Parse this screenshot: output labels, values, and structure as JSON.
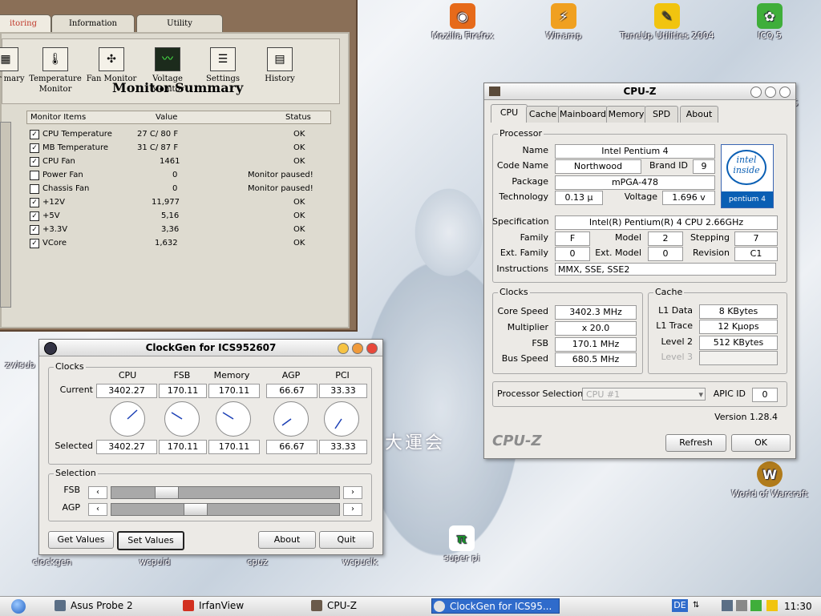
{
  "desktop": {
    "wallpaper_text": "大運会",
    "icons": [
      {
        "label": "Mozilla Firefox",
        "glyph": "◉",
        "color": "#e66a1a"
      },
      {
        "label": "Winamp",
        "glyph": "⚡",
        "color": "#f0a020"
      },
      {
        "label": "TuneUp Utilities 2004",
        "glyph": "✎",
        "color": "#f1c40f"
      },
      {
        "label": "ICQ 5",
        "glyph": "✿",
        "color": "#3fae3a"
      },
      {
        "label": "World of Warcraft",
        "glyph": "W",
        "color": "#b07b1b"
      },
      {
        "label": "super pi",
        "glyph": "π",
        "color": "#1b8a2a"
      },
      {
        "label": "clockgen",
        "glyph": "",
        "color": "#6c7a8a"
      },
      {
        "label": "wcpuid",
        "glyph": "",
        "color": "#6c7a8a"
      },
      {
        "label": "cpuz",
        "glyph": "",
        "color": "#6c7a8a"
      },
      {
        "label": "wcpuclk",
        "glyph": "",
        "color": "#6c7a8a"
      },
      {
        "label": "zwisub",
        "glyph": "",
        "color": "#6c7a8a"
      },
      {
        "label": "CS",
        "glyph": "",
        "color": "#6c7a8a"
      }
    ]
  },
  "probe": {
    "tabs": [
      "itoring",
      "Information",
      "Utility"
    ],
    "tools": [
      {
        "label": "itor mary",
        "glyph": "▦"
      },
      {
        "label": "Temperature Monitor",
        "glyph": "🌡"
      },
      {
        "label": "Fan Monitor",
        "glyph": "✣"
      },
      {
        "label": "Voltage Monitor",
        "glyph": "〰"
      },
      {
        "label": "Settings",
        "glyph": "☰"
      },
      {
        "label": "History",
        "glyph": "▤"
      }
    ],
    "title": "Monitor Summary",
    "columns": [
      "Monitor Items",
      "Value",
      "Status"
    ],
    "rows": [
      {
        "checked": true,
        "item": "CPU Temperature",
        "value": "27 C/ 80 F",
        "status": "OK"
      },
      {
        "checked": true,
        "item": "MB Temperature",
        "value": "31 C/ 87 F",
        "status": "OK"
      },
      {
        "checked": true,
        "item": "CPU Fan",
        "value": "1461",
        "status": "OK"
      },
      {
        "checked": false,
        "item": "Power Fan",
        "value": "0",
        "status": "Monitor paused!"
      },
      {
        "checked": false,
        "item": "Chassis Fan",
        "value": "0",
        "status": "Monitor paused!"
      },
      {
        "checked": true,
        "item": "+12V",
        "value": "11,977",
        "status": "OK"
      },
      {
        "checked": true,
        "item": "+5V",
        "value": "5,16",
        "status": "OK"
      },
      {
        "checked": true,
        "item": "+3.3V",
        "value": "3,36",
        "status": "OK"
      },
      {
        "checked": true,
        "item": "VCore",
        "value": "1,632",
        "status": "OK"
      }
    ]
  },
  "cpuz": {
    "title": "CPU-Z",
    "tabs": [
      "CPU",
      "Cache",
      "Mainboard",
      "Memory",
      "SPD",
      "About"
    ],
    "processor": {
      "legend": "Processor",
      "name_label": "Name",
      "name": "Intel Pentium 4",
      "codename_label": "Code Name",
      "codename": "Northwood",
      "brandid_label": "Brand ID",
      "brandid": "9",
      "package_label": "Package",
      "package": "mPGA-478",
      "technology_label": "Technology",
      "technology": "0.13 µ",
      "voltage_label": "Voltage",
      "voltage": "1.696 v",
      "spec_label": "Specification",
      "spec": "Intel(R) Pentium(R) 4 CPU 2.66GHz",
      "family_label": "Family",
      "family": "F",
      "model_label": "Model",
      "model": "2",
      "stepping_label": "Stepping",
      "stepping": "7",
      "extfamily_label": "Ext. Family",
      "extfamily": "0",
      "extmodel_label": "Ext. Model",
      "extmodel": "0",
      "revision_label": "Revision",
      "revision": "C1",
      "instructions_label": "Instructions",
      "instructions": "MMX, SSE, SSE2"
    },
    "logo": {
      "line1": "intel",
      "line2": "inside",
      "brand": "pentium 4"
    },
    "clocks": {
      "legend": "Clocks",
      "corespeed_label": "Core Speed",
      "corespeed": "3402.3 MHz",
      "multiplier_label": "Multiplier",
      "multiplier": "x 20.0",
      "fsb_label": "FSB",
      "fsb": "170.1 MHz",
      "busspeed_label": "Bus Speed",
      "busspeed": "680.5 MHz"
    },
    "cache": {
      "legend": "Cache",
      "l1data_label": "L1 Data",
      "l1data": "8 KBytes",
      "l1trace_label": "L1 Trace",
      "l1trace": "12 Kµops",
      "level2_label": "Level 2",
      "level2": "512 KBytes",
      "level3_label": "Level 3",
      "level3": ""
    },
    "selection_label": "Processor Selection",
    "selection_value": "CPU #1",
    "apic_label": "APIC ID",
    "apic": "0",
    "version": "Version 1.28.4",
    "brand_text": "CPU-Z",
    "refresh": "Refresh",
    "ok": "OK"
  },
  "clockgen": {
    "title": "ClockGen for ICS952607",
    "clocks_legend": "Clocks",
    "columns": [
      "CPU",
      "FSB",
      "Memory",
      "AGP",
      "PCI"
    ],
    "current_label": "Current",
    "current": [
      "3402.27",
      "170.11",
      "170.11",
      "66.67",
      "33.33"
    ],
    "selected_label": "Selected",
    "selected": [
      "3402.27",
      "170.11",
      "170.11",
      "66.67",
      "33.33"
    ],
    "selection_legend": "Selection",
    "fsb_label": "FSB",
    "agp_label": "AGP",
    "fsb_level": 0.21,
    "agp_level": 0.35,
    "buttons": {
      "get": "Get Values",
      "set": "Set Values",
      "about": "About",
      "quit": "Quit"
    }
  },
  "taskbar": {
    "tasks": [
      {
        "label": "Asus Probe 2",
        "color": "#5b6f86"
      },
      {
        "label": "IrfanView",
        "color": "#d23020"
      },
      {
        "label": "CPU-Z",
        "color": "#6a5a4a"
      },
      {
        "label": "ClockGen for ICS95...",
        "color": "#e2e2e2"
      }
    ],
    "lang": "DE",
    "clock": "11:30"
  }
}
